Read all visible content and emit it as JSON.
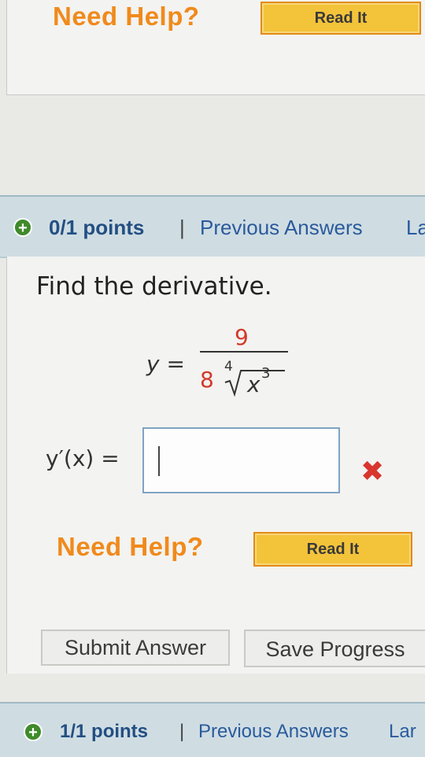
{
  "previous_question": {
    "need_help_label": "Need Help?",
    "read_it_label": "Read It"
  },
  "question": {
    "status_icon": "plus-icon",
    "points": "0/1 points",
    "separator": "|",
    "previous_answers": "Previous Answers",
    "header_cutoff": "La",
    "prompt": "Find the derivative.",
    "equation": {
      "lhs": "y =",
      "numerator": "9",
      "coefficient": "8",
      "root_index": "4",
      "radicand": "x",
      "exponent": "3"
    },
    "answer_label": "y′(x) =",
    "answer_value": "",
    "answer_status_icon": "x-icon",
    "need_help_label": "Need Help?",
    "read_it_label": "Read It",
    "submit_label": "Submit Answer",
    "save_label": "Save Progress"
  },
  "next_question": {
    "status_icon": "plus-icon",
    "points": "1/1 points",
    "separator": "|",
    "previous_answers": "Previous Answers",
    "header_cutoff": "Lar"
  },
  "colors": {
    "need_help": "#f08a1c",
    "read_it_bg": "#f3c33a",
    "header_bar": "#cfdde3",
    "points_text": "#234f82",
    "link_text": "#2a5a9c",
    "error_red": "#d8362e"
  }
}
